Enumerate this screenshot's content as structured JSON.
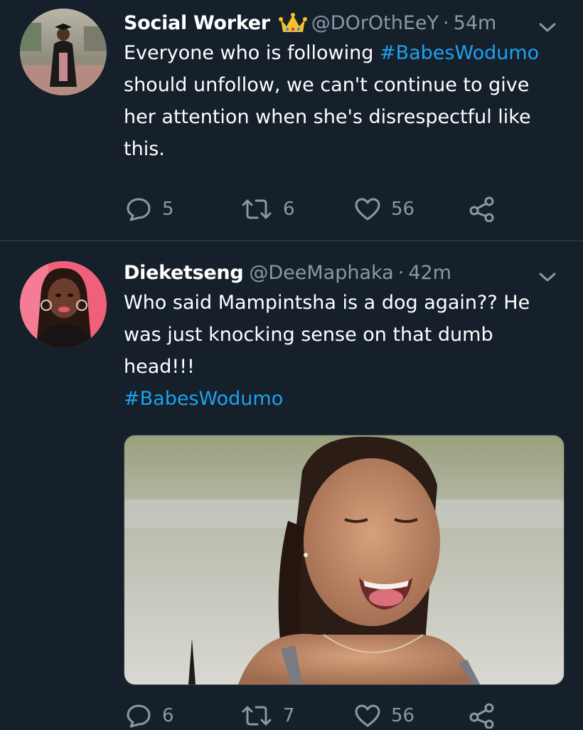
{
  "tweets": [
    {
      "display_name": "Social Worker",
      "has_crown": true,
      "handle": "@DOrOthEeY",
      "separator": "·",
      "time": "54m",
      "text_before": "Everyone who is following ",
      "hashtag": "#BabesWodumo",
      "text_after": " should unfollow, we can't continue to give her attention when she's disrespectful like this.",
      "replies": "5",
      "retweets": "6",
      "likes": "56"
    },
    {
      "display_name": "Dieketseng",
      "handle": "@DeeMaphaka",
      "separator": "·",
      "time": "42m",
      "text": "Who said Mampintsha is a dog again?? He was just knocking sense on that dumb head!!!",
      "hashtag": "#BabesWodumo",
      "replies": "6",
      "retweets": "7",
      "likes": "56"
    }
  ],
  "colors": {
    "background": "#15202b",
    "text": "#ffffff",
    "secondary": "#8899a6",
    "link": "#1da1f2",
    "divider": "#38444d"
  },
  "icons": [
    "chevron-down-icon",
    "reply-icon",
    "retweet-icon",
    "like-icon",
    "share-icon",
    "crown-emoji"
  ]
}
